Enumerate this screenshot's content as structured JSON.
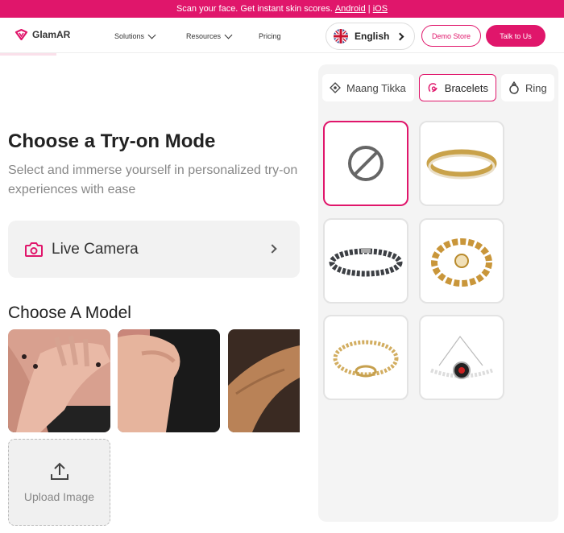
{
  "announcement": {
    "text": "Scan your face. Get instant skin scores. ",
    "android": "Android",
    "separator": " | ",
    "ios": "iOS"
  },
  "nav": {
    "brand": "GlamAR",
    "solutions": "Solutions",
    "resources": "Resources",
    "pricing": "Pricing",
    "language": "English",
    "demo_store": "Demo Store",
    "talk_to_us": "Talk to Us"
  },
  "tryon": {
    "title": "Choose a Try-on Mode",
    "subtitle": "Select and immerse yourself in personalized try-on experiences with ease",
    "live_camera": "Live Camera",
    "models_title": "Choose A Model",
    "upload_label": "Upload Image"
  },
  "categories": {
    "tabs": [
      "Maang Tikka",
      "Bracelets",
      "Ring"
    ],
    "active_index": 1
  },
  "products": {
    "items": [
      "none",
      "gold-bangle",
      "black-crystal-tennis-bracelet",
      "gold-chain-bracelet",
      "gold-link-bracelet",
      "silver-evil-eye-bracelet"
    ],
    "selected_index": 0
  },
  "colors": {
    "brand": "#e0166b",
    "panel": "#f4f4f4"
  }
}
